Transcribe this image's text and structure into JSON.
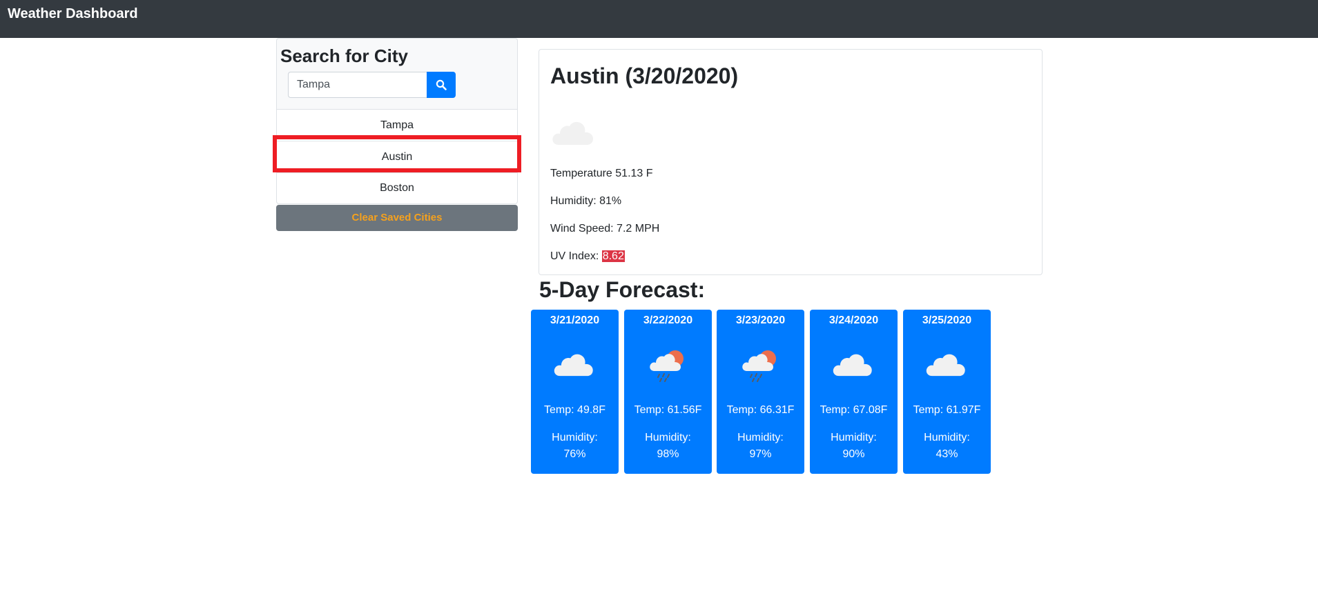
{
  "navbar": {
    "brand": "Weather Dashboard"
  },
  "sidebar": {
    "title": "Search for City",
    "search_value": "Tampa",
    "search_icon": "search-icon",
    "cities": [
      "Tampa",
      "Austin",
      "Boston"
    ],
    "highlighted_city": "Austin",
    "clear_label": "Clear Saved Cities"
  },
  "current": {
    "title": "Austin (3/20/2020)",
    "icon": "cloud-icon",
    "temperature": "Temperature 51.13 F",
    "humidity": "Humidity: 81%",
    "wind": "Wind Speed: 7.2 MPH",
    "uv_label": "UV Index: ",
    "uv_value": "8.62"
  },
  "forecast": {
    "title": "5-Day Forecast:",
    "days": [
      {
        "date": "3/21/2020",
        "icon": "cloud-icon",
        "temp": "Temp: 49.8F",
        "hum_label": "Humidity:",
        "hum_value": "76%"
      },
      {
        "date": "3/22/2020",
        "icon": "sun-rain-cloud-icon",
        "temp": "Temp: 61.56F",
        "hum_label": "Humidity:",
        "hum_value": "98%"
      },
      {
        "date": "3/23/2020",
        "icon": "sun-rain-cloud-icon",
        "temp": "Temp: 66.31F",
        "hum_label": "Humidity:",
        "hum_value": "97%"
      },
      {
        "date": "3/24/2020",
        "icon": "cloud-icon",
        "temp": "Temp: 67.08F",
        "hum_label": "Humidity:",
        "hum_value": "90%"
      },
      {
        "date": "3/25/2020",
        "icon": "cloud-icon",
        "temp": "Temp: 61.97F",
        "hum_label": "Humidity:",
        "hum_value": "43%"
      }
    ]
  },
  "colors": {
    "navbar": "#343a40",
    "primary": "#007bff",
    "secondary": "#6c757d",
    "clear_text": "#f5a11d",
    "uv_badge": "#dc3545",
    "highlight": "#ee1d24"
  }
}
